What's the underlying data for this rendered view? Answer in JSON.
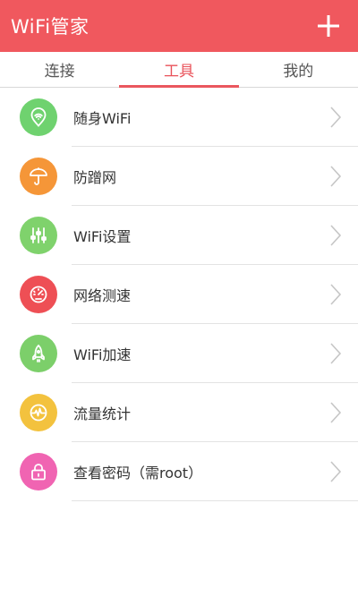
{
  "app_bar": {
    "title": "WiFi管家"
  },
  "tabs": [
    {
      "label": "连接"
    },
    {
      "label": "工具"
    },
    {
      "label": "我的"
    }
  ],
  "active_tab": "工具",
  "colors": {
    "brand": "#f0585e",
    "wifi_portable": "#6fd26f",
    "anti_leech": "#f59638",
    "wifi_settings": "#7fd26c",
    "speed_test": "#ee4f55",
    "wifi_boost": "#7ccf6a",
    "traffic_stats": "#f3c23e",
    "view_password": "#f064b2"
  },
  "tools": [
    {
      "label": "随身WiFi",
      "icon": "wifi-icon"
    },
    {
      "label": "防蹭网",
      "icon": "umbrella-icon"
    },
    {
      "label": "WiFi设置",
      "icon": "sliders-icon"
    },
    {
      "label": "网络测速",
      "icon": "speedometer-icon"
    },
    {
      "label": "WiFi加速",
      "icon": "rocket-icon"
    },
    {
      "label": "流量统计",
      "icon": "pulse-icon"
    },
    {
      "label": "查看密码（需root）",
      "icon": "lock-icon"
    }
  ]
}
